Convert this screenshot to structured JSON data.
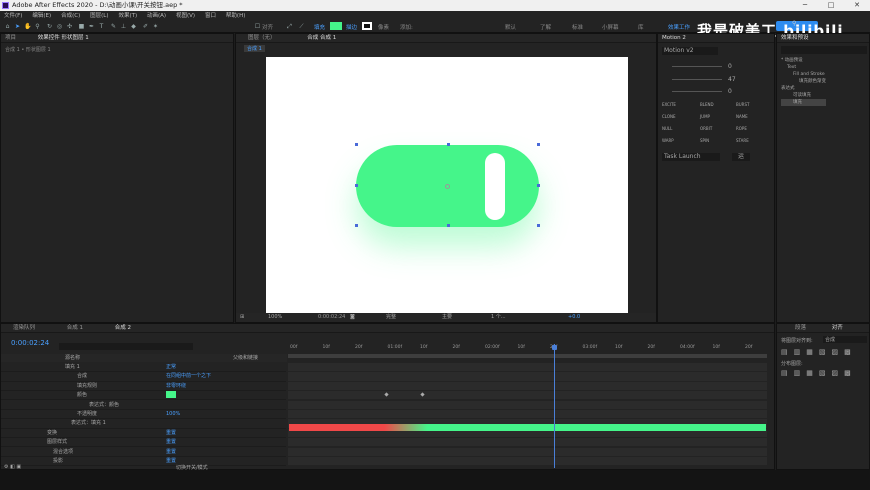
{
  "titlebar": {
    "title": "Adobe After Effects 2020 - D:\\动画小课\\开关按钮.aep *",
    "minimize": "─",
    "maximize": "□",
    "close": "✕"
  },
  "menu": [
    "文件(F)",
    "编辑(E)",
    "合成(C)",
    "图层(L)",
    "效果(T)",
    "动画(A)",
    "视图(V)",
    "窗口",
    "帮助(H)"
  ],
  "toolbar": {
    "align_label": "对齐",
    "fill_label": "填充",
    "stroke_label": "描边",
    "stroke_px": "像素",
    "add_label": "添加:",
    "fill_color": "#45f58a",
    "workspaces": [
      "默认",
      "了解",
      "标准",
      "小屏幕",
      "库"
    ],
    "active_workspace": "效果工作",
    "search_placeholder": "搜索帮助"
  },
  "watermark": "我是破美工 bilibili",
  "left_panel": {
    "tab1": "项目",
    "tab2": "效果控件 形状图层 1",
    "sub": "合成 1 • 形状图层 1"
  },
  "comp_panel": {
    "tab_layer": "图层（无）",
    "tab_comp": "合成 合成 1",
    "comp_chip": "合成 1",
    "zoom": "100%",
    "time": "0:00:02:24",
    "quality": "完整",
    "camera": "主要",
    "views": "1 个...",
    "offset": "+0.0"
  },
  "motion_panel": {
    "tab": "Motion 2",
    "preset": "Motion v2",
    "v1": "0",
    "v2": "47",
    "v3": "0",
    "buttons": [
      "EXCITE",
      "BLEND",
      "BURST",
      "CLONE",
      "JUMP",
      "NAME",
      "NULL",
      "ORBIT",
      "ROPE",
      "WARP",
      "SPIN",
      "STARE"
    ],
    "task": "Task Launch",
    "go": "运"
  },
  "project_panel": {
    "tab": "效果和预设",
    "search_placeholder": "",
    "items": [
      "* 动画预设",
      "Text",
      "Fill and Stroke",
      "填充颜色渐变",
      "表达式",
      "可读填充",
      "填充"
    ]
  },
  "timeline": {
    "tab_render": "渲染队列",
    "tab_comp1": "合成 1",
    "tab_comp2": "合成 2",
    "time": "0:00:02:24",
    "col_source": "源名称",
    "col_parent": "父级和链接",
    "ruler": [
      "00f",
      "10f",
      "20f",
      "01:00f",
      "10f",
      "20f",
      "02:00f",
      "10f",
      "20f",
      "03:00f",
      "10f",
      "20f",
      "04:00f",
      "10f",
      "20f"
    ],
    "rows": [
      {
        "name": "填充 1",
        "value": "正常"
      },
      {
        "name": "合成",
        "value": "在同组中前一个之下"
      },
      {
        "name": "填充规则",
        "value": "非零环绕"
      },
      {
        "name": "颜色",
        "value": ""
      },
      {
        "name": "表达式：颜色",
        "value": ""
      },
      {
        "name": "不透明度",
        "value": "100%"
      },
      {
        "name": "表达式：填充 1",
        "value": ""
      },
      {
        "name": "变换",
        "value": "重置"
      },
      {
        "name": "图层样式",
        "value": "重置"
      },
      {
        "name": "混合选项",
        "value": "重置"
      },
      {
        "name": "投影",
        "value": "重置"
      }
    ],
    "footer": "切换开关/模式"
  },
  "align_panel": {
    "tab1": "段落",
    "tab2": "对齐",
    "align_to_label": "将图层对齐到:",
    "align_to_value": "合成",
    "distribute_label": "分布图层:"
  }
}
